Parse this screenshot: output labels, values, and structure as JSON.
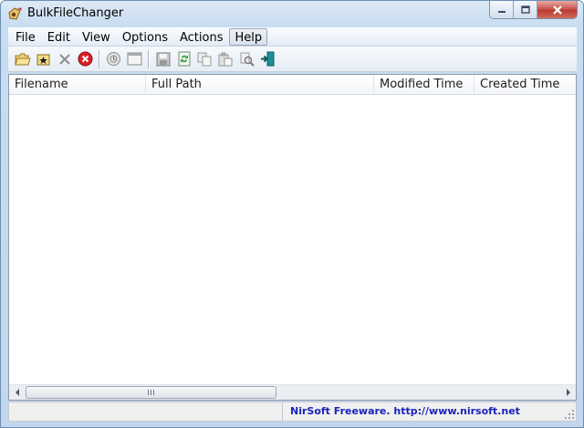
{
  "window": {
    "title": "BulkFileChanger"
  },
  "menu": {
    "items": [
      {
        "label": "File"
      },
      {
        "label": "Edit"
      },
      {
        "label": "View"
      },
      {
        "label": "Options"
      },
      {
        "label": "Actions"
      },
      {
        "label": "Help"
      }
    ]
  },
  "toolbar": {
    "icons": [
      "open-folder-icon",
      "add-files-icon",
      "remove-icon",
      "clear-icon",
      "properties-icon",
      "window-icon",
      "save-icon",
      "refresh-icon",
      "copy-icon",
      "paste-icon",
      "find-icon",
      "exit-icon"
    ]
  },
  "list": {
    "columns": [
      {
        "label": "Filename"
      },
      {
        "label": "Full Path"
      },
      {
        "label": "Modified Time"
      },
      {
        "label": "Created Time"
      }
    ],
    "rows": []
  },
  "statusbar": {
    "text": "NirSoft Freeware.  http://www.nirsoft.net"
  },
  "colors": {
    "status_link": "#1b24b8",
    "close_button": "#c75050"
  }
}
